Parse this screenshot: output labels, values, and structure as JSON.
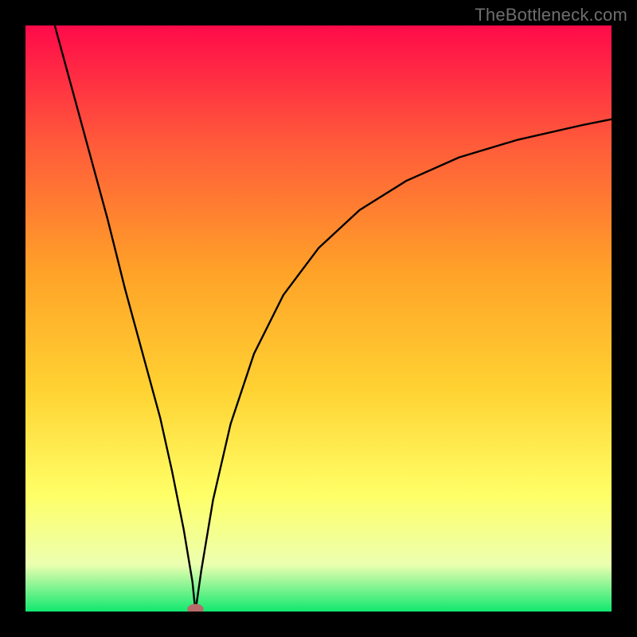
{
  "watermark": "TheBottleneck.com",
  "colors": {
    "top": "#ff0a4a",
    "mid1": "#ff5a3a",
    "mid2": "#ffa228",
    "mid3": "#ffd232",
    "yellow": "#ffff66",
    "pale": "#ecffb0",
    "green": "#11e86f",
    "frame": "#000000",
    "curve": "#000000",
    "marker": "#b86b6b"
  },
  "chart_data": {
    "type": "line",
    "title": "",
    "xlabel": "",
    "ylabel": "",
    "xlim": [
      0,
      100
    ],
    "ylim": [
      0,
      100
    ],
    "minimum_x": 29,
    "marker": {
      "x": 29,
      "y": 0,
      "rx": 1.4,
      "ry": 0.9
    },
    "series": [
      {
        "name": "left-branch",
        "x": [
          5,
          8,
          11,
          14,
          17,
          20,
          23,
          25,
          27,
          28.5,
          29
        ],
        "values": [
          100,
          89,
          78,
          67,
          55,
          44,
          33,
          24,
          14,
          5,
          0
        ]
      },
      {
        "name": "right-branch",
        "x": [
          29,
          30,
          32,
          35,
          39,
          44,
          50,
          57,
          65,
          74,
          84,
          95,
          100
        ],
        "values": [
          0,
          7,
          19,
          32,
          44,
          54,
          62,
          68.5,
          73.5,
          77.5,
          80.5,
          83,
          84
        ]
      }
    ]
  }
}
